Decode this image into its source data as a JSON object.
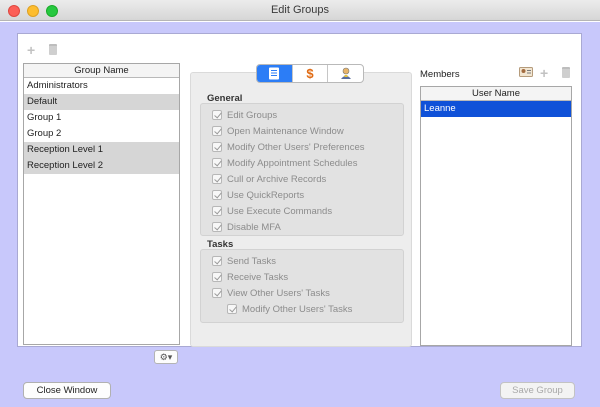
{
  "window": {
    "title": "Edit Groups"
  },
  "groups": {
    "column_header": "Group Name",
    "rows": [
      "Administrators",
      "Default",
      "Group 1",
      "Group 2",
      "Reception Level 1",
      "Reception Level 2"
    ]
  },
  "permissions": {
    "tabs": [
      {
        "icon": "document-list-icon",
        "selected": true
      },
      {
        "icon": "dollar-icon",
        "selected": false
      },
      {
        "icon": "user-badge-icon",
        "selected": false
      }
    ],
    "general": {
      "label": "General",
      "items": [
        "Edit Groups",
        "Open Maintenance Window",
        "Modify Other Users' Preferences",
        "Modify Appointment Schedules",
        "Cull or Archive Records",
        "Use QuickReports",
        "Use Execute Commands",
        "Disable MFA"
      ]
    },
    "tasks": {
      "label": "Tasks",
      "items": [
        "Send Tasks",
        "Receive Tasks",
        "View Other Users' Tasks",
        "Modify Other Users' Tasks"
      ]
    }
  },
  "members": {
    "label": "Members",
    "column_header": "User Name",
    "rows": [
      "Leanne"
    ]
  },
  "buttons": {
    "close": "Close Window",
    "save": "Save Group"
  },
  "colors": {
    "window_background": "#c8c8fb",
    "selection": "#0f51d8",
    "accent": "#2c7df6"
  }
}
